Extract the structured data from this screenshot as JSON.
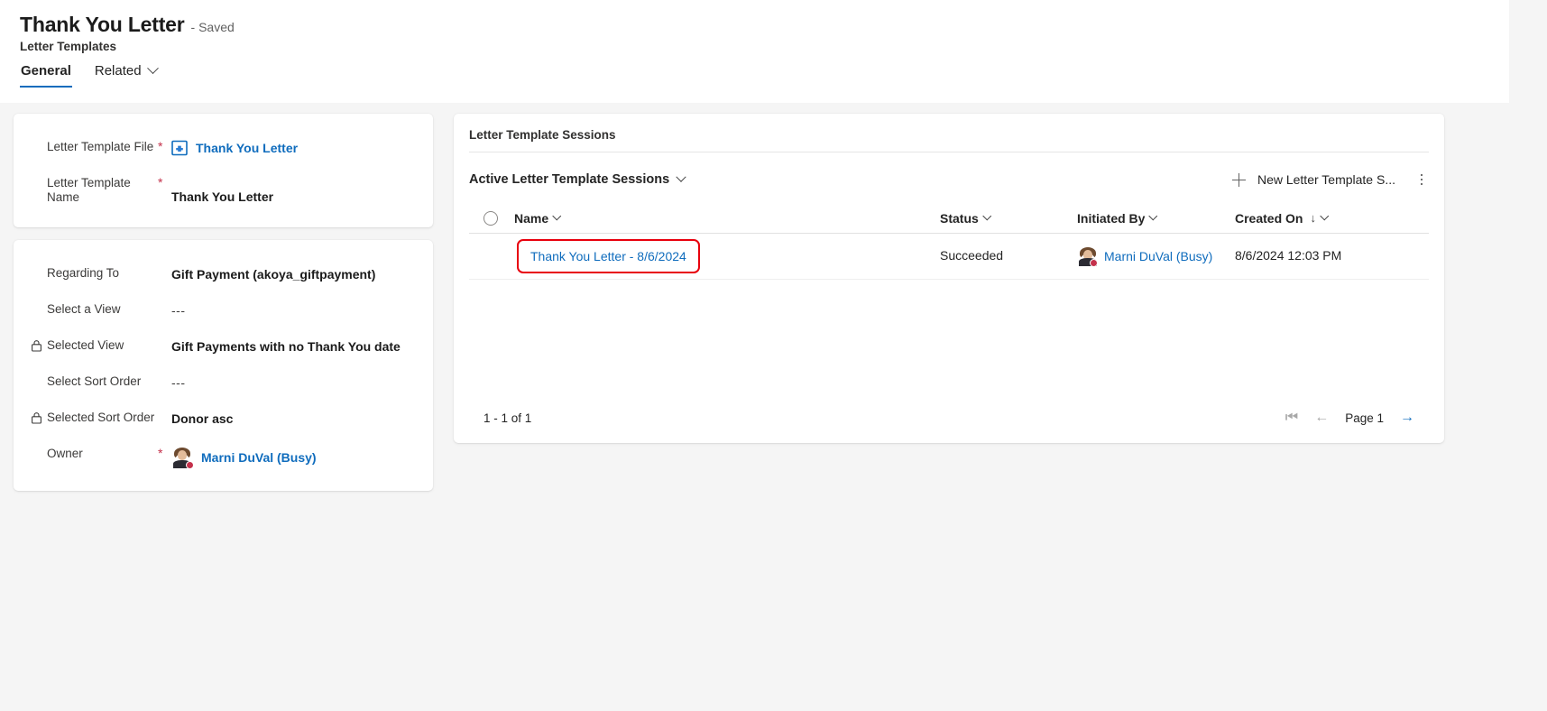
{
  "header": {
    "record_title": "Thank You Letter",
    "saved_state": "- Saved",
    "entity_name": "Letter Templates",
    "tabs": [
      {
        "label": "General",
        "active": true
      },
      {
        "label": "Related",
        "active": false
      }
    ]
  },
  "form": {
    "card1": [
      {
        "label": "Letter Template File",
        "required": true,
        "locked": false,
        "value": "Thank You Letter",
        "type": "file-link",
        "icon": "file-template-icon"
      },
      {
        "label": "Letter Template Name",
        "required": true,
        "locked": false,
        "value": "Thank You Letter",
        "type": "text"
      }
    ],
    "card2": [
      {
        "label": "Regarding To",
        "required": false,
        "locked": false,
        "value": "Gift Payment (akoya_giftpayment)",
        "type": "text"
      },
      {
        "label": "Select a View",
        "required": false,
        "locked": false,
        "value": "---",
        "type": "muted"
      },
      {
        "label": "Selected View",
        "required": false,
        "locked": true,
        "value": "Gift Payments with no Thank You date",
        "type": "text"
      },
      {
        "label": "Select Sort Order",
        "required": false,
        "locked": false,
        "value": "---",
        "type": "muted"
      },
      {
        "label": "Selected Sort Order",
        "required": false,
        "locked": true,
        "value": "Donor asc",
        "type": "text"
      },
      {
        "label": "Owner",
        "required": true,
        "locked": false,
        "value": "Marni DuVal (Busy)",
        "type": "person"
      }
    ]
  },
  "subgrid": {
    "panel_title": "Letter Template Sessions",
    "view_name": "Active Letter Template Sessions",
    "new_button_label": "New Letter Template S...",
    "overflow_label": "More commands",
    "columns": [
      {
        "label": "Name",
        "sorted": false
      },
      {
        "label": "Status",
        "sorted": false
      },
      {
        "label": "Initiated By",
        "sorted": false
      },
      {
        "label": "Created On",
        "sorted": true,
        "sort_direction": "↓"
      }
    ],
    "rows": [
      {
        "name": "Thank You Letter - 8/6/2024",
        "status": "Succeeded",
        "initiated_by": "Marni DuVal (Busy)",
        "created_on": "8/6/2024 12:03 PM",
        "highlighted": true
      }
    ],
    "footer": {
      "count_text": "1 - 1 of 1",
      "page_label": "Page 1",
      "first_page_icon": "first-page-icon",
      "prev_page_icon": "previous-page-icon",
      "next_page_icon": "next-page-icon"
    }
  },
  "colors": {
    "accent": "#0f6cbd",
    "required": "#c4314b",
    "highlight": "#e8000d",
    "presence_busy": "#c4314b"
  }
}
